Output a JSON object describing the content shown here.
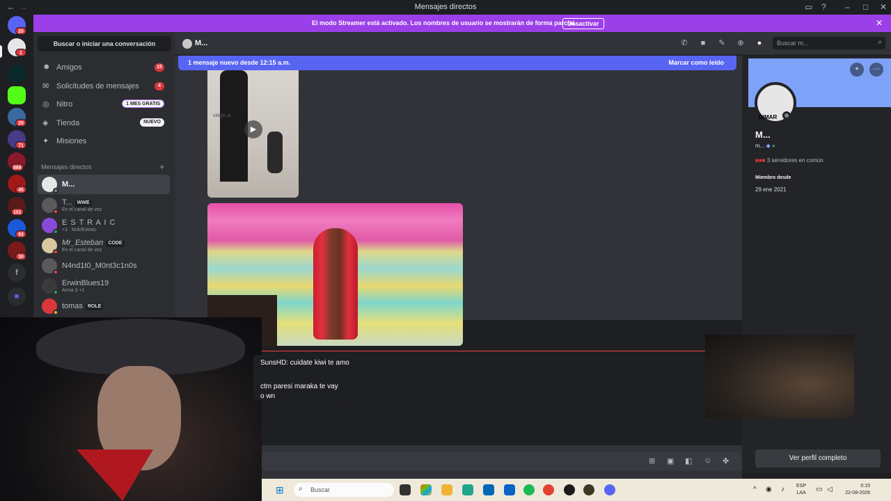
{
  "window": {
    "title": "Mensajes directos",
    "back": "←",
    "forward": "→"
  },
  "rail": {
    "badges": [
      "20",
      "1",
      "20",
      "71",
      "889",
      "45",
      "101",
      "93",
      "30"
    ],
    "letter_server": "f"
  },
  "banner": {
    "text": "El modo Streamer está activado. Los nombres de usuario se mostrarán de forma parcial.",
    "button": "Desactivar"
  },
  "sidebar": {
    "search": "Buscar o iniciar una conversación",
    "nav": [
      {
        "label": "Amigos",
        "badge": "15"
      },
      {
        "label": "Solicitudes de mensajes",
        "badge": "4"
      },
      {
        "label": "Nitro",
        "tag": "1 MES GRATIS"
      },
      {
        "label": "Tienda",
        "tag": "NUEVO"
      },
      {
        "label": "Misiones"
      }
    ],
    "dm_header": "Mensajes directos",
    "dms": [
      {
        "name": "M...",
        "status_color": "#80848e"
      },
      {
        "name": "T...",
        "tag": "WWE",
        "sub": "En el canal de voz",
        "status_color": "#f23f43"
      },
      {
        "name": "E S T R A I C",
        "sub": "+1 · kick/Estraic",
        "status_color": "#23a55a"
      },
      {
        "name": "Mr_Esteban",
        "tag": "CODE",
        "sub": "En el canal de voz",
        "status_color": "#f23f43"
      },
      {
        "name": "N4nd1t0_M0nt3c1n0s",
        "status_color": "#f23f43"
      },
      {
        "name": "ErwinBlues19",
        "sub": "Arma 3 +1",
        "status_color": "#23a55a"
      },
      {
        "name": "tomas",
        "tag": "ROLE",
        "status_color": "#f0b232"
      }
    ]
  },
  "header": {
    "name": "M...",
    "search_placeholder": "Buscar m..."
  },
  "chat": {
    "new_messages": "1 mensaje nuevo desde 12:15 a.m.",
    "mark_read": "Marcar como leído",
    "watermark": "vidgie.ai"
  },
  "overlay_chat": {
    "lines": [
      "SunsHD: cuidate kiwi te amo",
      "ctm paresi maraka te vay",
      "o wn"
    ]
  },
  "profile": {
    "avatar_text": "DIMAR",
    "display_name": "M...",
    "username": "m...",
    "common_servers": "3 servidores en común",
    "member_since_label": "Miembro desde",
    "member_since": "29 ene 2021",
    "full_profile_button": "Ver perfil completo"
  },
  "taskbar": {
    "search_placeholder": "Buscar",
    "lang_top": "ESP",
    "lang_bottom": "LAA",
    "time": "0:15",
    "date": "22-08-2026"
  },
  "colors": {
    "accent": "#5865f2",
    "streamer": "#9b40e8",
    "danger": "#da373c"
  }
}
